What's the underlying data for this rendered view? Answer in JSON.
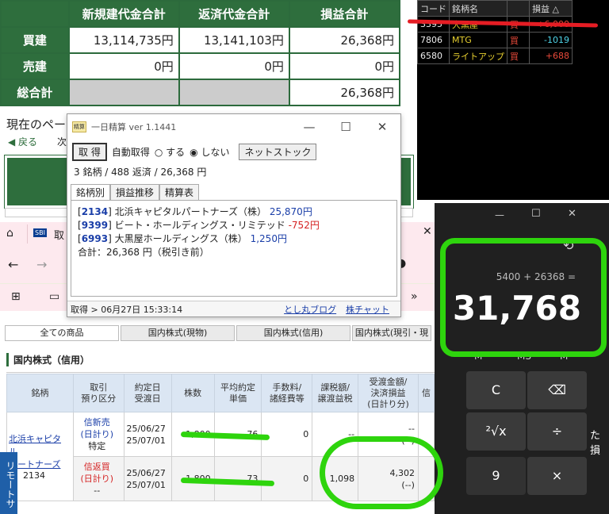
{
  "summary": {
    "headers": [
      "新規建代金合計",
      "返済代金合計",
      "損益合計"
    ],
    "rows": [
      {
        "label": "買建",
        "new": "13,114,735円",
        "close": "13,141,103円",
        "pl": "26,368円"
      },
      {
        "label": "売建",
        "new": "0円",
        "close": "0円",
        "pl": "0円"
      },
      {
        "label": "総合計",
        "new": "",
        "close": "",
        "pl": "26,368円"
      }
    ]
  },
  "page_current": "現在のペー",
  "back_label": "◀ 戻る",
  "next_label": "次",
  "ticker": {
    "headers": [
      "コード",
      "銘柄名",
      "",
      "損益 △"
    ],
    "rows": [
      {
        "code": "3395",
        "name": "大黒屋",
        "side": "買",
        "pl": "+6,000"
      },
      {
        "code": "7806",
        "name": "MTG",
        "side": "買",
        "pl": "-1019"
      },
      {
        "code": "6580",
        "name": "ライトアップ",
        "side": "買",
        "pl": "+688"
      }
    ]
  },
  "seisan": {
    "title": "一日精算 ver 1.1441",
    "icon_text": "精算",
    "btn_get": "取 得",
    "auto_label": "自動取得",
    "radio_on": "する",
    "radio_off": "しない",
    "btn_net": "ネットストック",
    "summary": "3 銘柄 / 488 返済 / 26,368 円",
    "tabs": [
      "銘柄別",
      "損益推移",
      "精算表"
    ],
    "items": [
      {
        "code": "2134",
        "name": "北浜キャピタルパートナーズ（株）",
        "amount": "25,870円"
      },
      {
        "code": "9399",
        "name": "ビート・ホールディングス・リミテッド",
        "amount": "-752円"
      },
      {
        "code": "6993",
        "name": "大黒屋ホールディングス（株）",
        "amount": "1,250円"
      }
    ],
    "total": "合計：26,368 円（税引き前）",
    "status": "取得 > 06月27日 15:33:14",
    "link1": "とし丸ブログ",
    "link2": "株チャット"
  },
  "browser": {
    "tab_icon": "SBI",
    "tab_title": "取",
    "product_tabs": [
      "全ての商品",
      "国内株式(現物)",
      "国内株式(信用)",
      "国内株式(現引・現"
    ],
    "section_title": "国内株式（信用）",
    "col_headers": [
      "銘柄",
      "取引\n預り区分",
      "約定日\n受渡日",
      "株数",
      "平均約定\n単価",
      "手数料/\n諸経費等",
      "課税額/\n譲渡益税",
      "受渡金額/\n決済損益\n(日計り分)",
      "信"
    ],
    "stock_name": "北浜キャピタル\nパートナーズ",
    "stock_code": "2134",
    "side_label": "リモートサ",
    "rows": [
      {
        "kind": "信新売",
        "day": "(日計り)",
        "acct": "特定",
        "date1": "25/06/27",
        "date2": "25/07/01",
        "qty": "1,800",
        "price": "76",
        "fee": "0",
        "tax": "--",
        "amount": "--",
        "pl": "(--)"
      },
      {
        "kind": "信返買",
        "day": "(日計り)",
        "acct": "--",
        "date1": "25/06/27",
        "date2": "25/07/01",
        "qty": "1,800",
        "price": "73",
        "fee": "0",
        "tax": "1,098",
        "amount": "4,302",
        "pl": "(--)"
      }
    ]
  },
  "calculator": {
    "expression": "5400 + 26368 =",
    "result": "31,768",
    "keys": [
      "M−",
      "MS",
      "M",
      "C",
      "⌫",
      "²√x",
      "÷",
      "9",
      "×"
    ],
    "side_text": "た 損"
  }
}
